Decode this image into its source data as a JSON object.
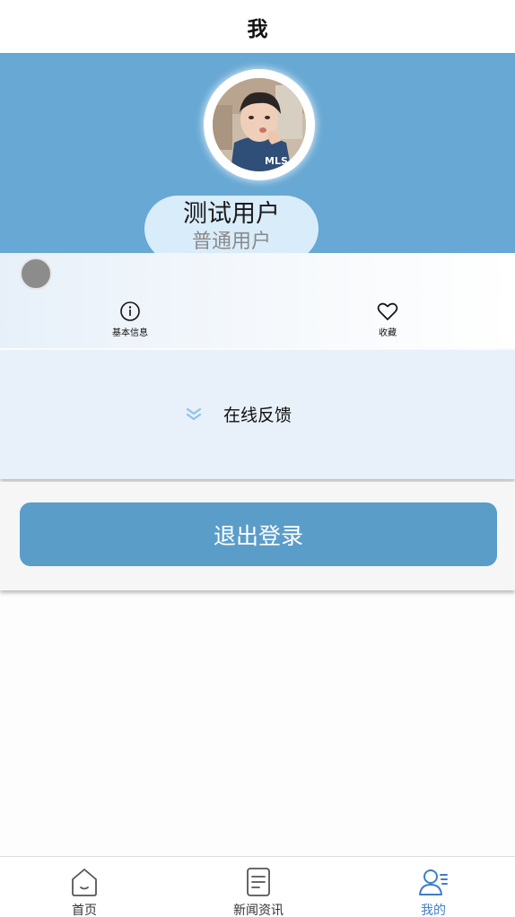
{
  "header": {
    "title": "我"
  },
  "profile": {
    "name": "测试用户",
    "role": "普通用户",
    "avatar_text": "MLS"
  },
  "quick_actions": [
    {
      "label": "基本信息",
      "icon": "info-circle-icon"
    },
    {
      "label": "收藏",
      "icon": "heart-icon"
    }
  ],
  "feedback": {
    "label": "在线反馈",
    "icon": "double-chevron-down-icon"
  },
  "logout": {
    "label": "退出登录"
  },
  "tabbar": {
    "items": [
      {
        "label": "首页",
        "icon": "home-icon"
      },
      {
        "label": "新闻资讯",
        "icon": "document-icon"
      },
      {
        "label": "我的",
        "icon": "user-icon"
      }
    ],
    "active_index": 2
  },
  "colors": {
    "hero_bg": "#67a8d4",
    "button_bg": "#5b9dc9",
    "accent": "#3f7ec9",
    "feedback_bg": "#e8f0fa"
  }
}
